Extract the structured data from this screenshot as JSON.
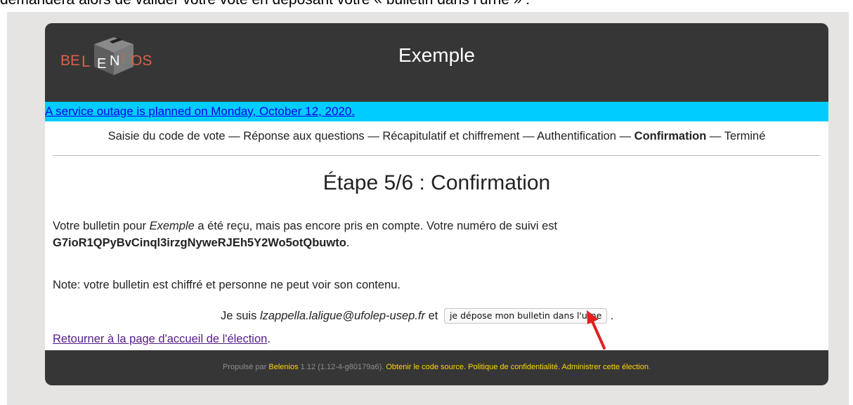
{
  "document_fragment": "demandera alors de valider votre vote en déposant votre « bulletin dans l’urne » :",
  "logo": {
    "text_left": "BE",
    "text_mid1": "L",
    "text_mid2": "E",
    "text_mid3": "N",
    "text_mid4": "I",
    "text_right": "OS"
  },
  "header": {
    "title": "Exemple"
  },
  "notice": {
    "text": "A service outage is planned on Monday, October 12, 2020."
  },
  "steps": {
    "items": [
      "Saisie du code de vote",
      "Réponse aux questions",
      "Récapitulatif et chiffrement",
      "Authentification",
      "Confirmation",
      "Terminé"
    ],
    "separator": " — ",
    "current_index": 4
  },
  "main": {
    "title": "Étape 5/6 : Confirmation",
    "receipt_prefix": "Votre bulletin pour ",
    "election_name": "Exemple",
    "receipt_suffix": " a été reçu, mais pas encore pris en compte. Votre numéro de suivi est",
    "tracking_number": "G7ioR1QPyBvCinql3irzgNyweRJEh5Y2Wo5otQbuwto",
    "tracking_end": ".",
    "note": "Note: votre bulletin est chiffré et personne ne peut voir son contenu.",
    "confirm_prefix": "Je suis ",
    "voter_email": "lzappella.laligue@ufolep-usep.fr",
    "confirm_mid": " et ",
    "cast_button": "je dépose mon bulletin dans l'urne",
    "confirm_end": " .",
    "return_link": "Retourner à la page d'accueil de l'élection",
    "return_end": "."
  },
  "footer": {
    "powered_prefix": "Propulsé par ",
    "belenios_link": "Belenios",
    "version": " 1.12 (1.12-4-g80179a6). ",
    "source_link": "Obtenir le code source",
    "sep1": ". ",
    "privacy_link": "Politique de confidentialité",
    "sep2": ". ",
    "admin_link": "Administrer cette élection",
    "end": "."
  },
  "colors": {
    "header_bg": "#363636",
    "notice_bg": "#00ccff",
    "footer_link": "#ffd700",
    "arrow": "#e02020",
    "visited_link": "#551a8b"
  }
}
